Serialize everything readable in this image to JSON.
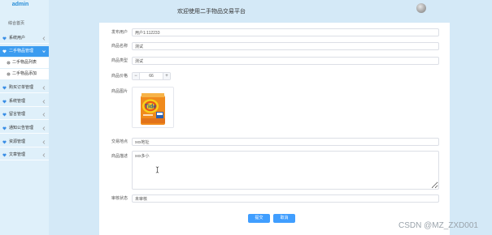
{
  "sidebar": {
    "brand": "admin",
    "home": "综合首页",
    "items": [
      {
        "label": "系统用户",
        "icon": "heart-icon"
      },
      {
        "label": "二手物品管理",
        "icon": "heart-icon",
        "active": true,
        "children": [
          {
            "label": "二手物品列表",
            "icon": "gear-icon"
          },
          {
            "label": "二手物品添加",
            "icon": "gear-icon"
          }
        ]
      },
      {
        "label": "购买订单管理",
        "icon": "heart-icon"
      },
      {
        "label": "系统管理",
        "icon": "heart-icon"
      },
      {
        "label": "留言管理",
        "icon": "heart-icon"
      },
      {
        "label": "通知公告管理",
        "icon": "heart-icon"
      },
      {
        "label": "资源管理",
        "icon": "heart-icon"
      },
      {
        "label": "文章管理",
        "icon": "heart-icon"
      }
    ]
  },
  "header": {
    "title": "欢迎使用二手物品交易平台",
    "avatar_icon": "user-avatar"
  },
  "form": {
    "publisher": {
      "label": "发布用户",
      "value": "用户1:112233"
    },
    "name": {
      "label": "商品名称",
      "value": "测试"
    },
    "type": {
      "label": "商品类型",
      "value": "测试"
    },
    "price": {
      "label": "商品价格",
      "value": "66",
      "decrement": "−",
      "increment": "+"
    },
    "image": {
      "label": "商品图片",
      "logo_text": "Tide"
    },
    "location": {
      "label": "交易地点",
      "value": "xxx地址"
    },
    "description": {
      "label": "商品描述",
      "value": "xxx多小"
    },
    "audit": {
      "label": "审核状态",
      "value": "未审核"
    },
    "submit": "提交",
    "cancel": "取消"
  },
  "watermark": "CSDN @MZ_ZXD001",
  "colors": {
    "page_bg": "#d4e9f7",
    "sidebar_active": "#3b9cf0",
    "button": "#409eff",
    "brand": "#2b8fd8"
  }
}
